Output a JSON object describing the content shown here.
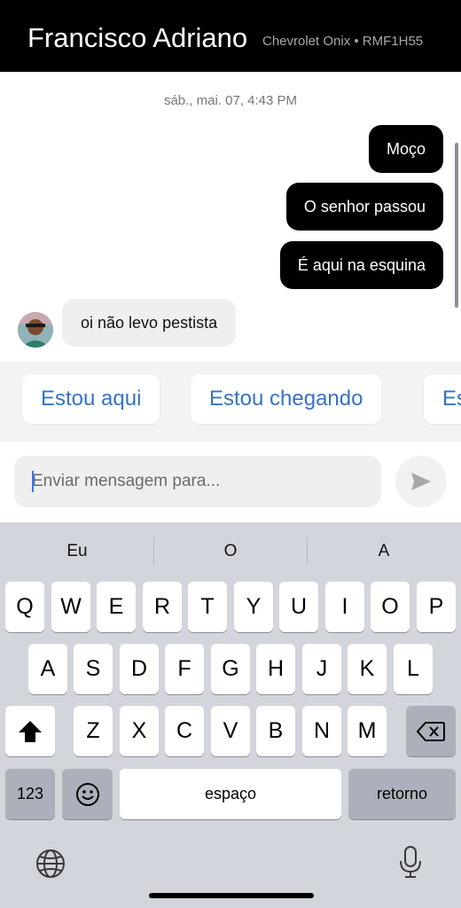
{
  "header": {
    "driver_name": "Francisco Adriano",
    "vehicle_info": "Chevrolet Onix • RMF1H55"
  },
  "chat": {
    "timestamp": "sáb., mai. 07, 4:43 PM",
    "outgoing": [
      "Moço",
      "O senhor passou",
      "É aqui na esquina"
    ],
    "incoming": [
      "oi não levo pestista"
    ]
  },
  "quick_replies": [
    "Estou aqui",
    "Estou chegando",
    "Es"
  ],
  "composer": {
    "placeholder": "Enviar mensagem para...",
    "value": ""
  },
  "keyboard": {
    "suggestions": [
      "Eu",
      "O",
      "A"
    ],
    "row1": [
      "Q",
      "W",
      "E",
      "R",
      "T",
      "Y",
      "U",
      "I",
      "O",
      "P"
    ],
    "row2": [
      "A",
      "S",
      "D",
      "F",
      "G",
      "H",
      "J",
      "K",
      "L"
    ],
    "row3": [
      "Z",
      "X",
      "C",
      "V",
      "B",
      "N",
      "M"
    ],
    "numbers_label": "123",
    "space_label": "espaço",
    "return_label": "retorno"
  },
  "colors": {
    "header_bg": "#000000",
    "outgoing_bubble": "#000000",
    "incoming_bubble": "#efefef",
    "quick_reply_text": "#3573c6",
    "keyboard_bg": "#d2d5db"
  },
  "icons": {
    "send": "send-arrow-icon",
    "shift": "shift-arrow-icon",
    "backspace": "backspace-icon",
    "emoji": "emoji-icon",
    "globe": "globe-icon",
    "microphone": "microphone-icon"
  }
}
